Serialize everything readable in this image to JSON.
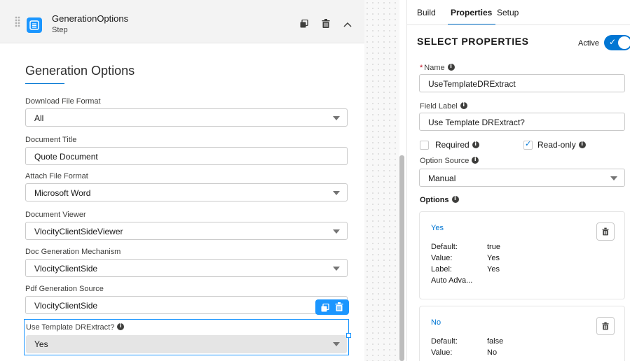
{
  "step": {
    "title": "GenerationOptions",
    "subtitle": "Step"
  },
  "form": {
    "section_title": "Generation Options",
    "fields": [
      {
        "label": "Download File Format",
        "value": "All",
        "type": "select"
      },
      {
        "label": "Document Title",
        "value": "Quote Document",
        "type": "text"
      },
      {
        "label": "Attach File Format",
        "value": "Microsoft Word",
        "type": "select"
      },
      {
        "label": "Document Viewer",
        "value": "VlocityClientSideViewer",
        "type": "select"
      },
      {
        "label": "Doc Generation Mechanism",
        "value": "VlocityClientSide",
        "type": "select"
      },
      {
        "label": "Pdf Generation Source",
        "value": "VlocityClientSide",
        "type": "text"
      }
    ],
    "selected_field": {
      "label": "Use Template DRExtract?",
      "value": "Yes"
    }
  },
  "tabs": [
    {
      "label": "Build"
    },
    {
      "label": "Properties"
    },
    {
      "label": "Setup"
    }
  ],
  "props": {
    "title": "SELECT PROPERTIES",
    "active_label": "Active",
    "active": true,
    "name_label": "Name",
    "name_required_mark": "*",
    "name_value": "UseTemplateDRExtract",
    "field_label_label": "Field Label",
    "field_label_value": "Use Template DRExtract?",
    "required_label": "Required",
    "required_checked": false,
    "readonly_label": "Read-only",
    "readonly_checked": true,
    "option_source_label": "Option Source",
    "option_source_value": "Manual",
    "options_heading": "Options",
    "options": [
      {
        "name": "Yes",
        "default_key": "Default:",
        "default": "true",
        "value_key": "Value:",
        "value": "Yes",
        "label_key": "Label:",
        "label": "Yes",
        "extra": "Auto Adva..."
      },
      {
        "name": "No",
        "default_key": "Default:",
        "default": "false",
        "value_key": "Value:",
        "value": "No"
      }
    ]
  },
  "colors": {
    "brand": "#0176d3",
    "selection": "#1b96ff",
    "required": "#ba0517"
  },
  "icons": {
    "step": "list-icon",
    "copy": "copy-icon",
    "delete": "trash-icon",
    "collapse": "chevron-up-icon",
    "dropdown": "caret-down-icon",
    "info": "info-icon"
  }
}
